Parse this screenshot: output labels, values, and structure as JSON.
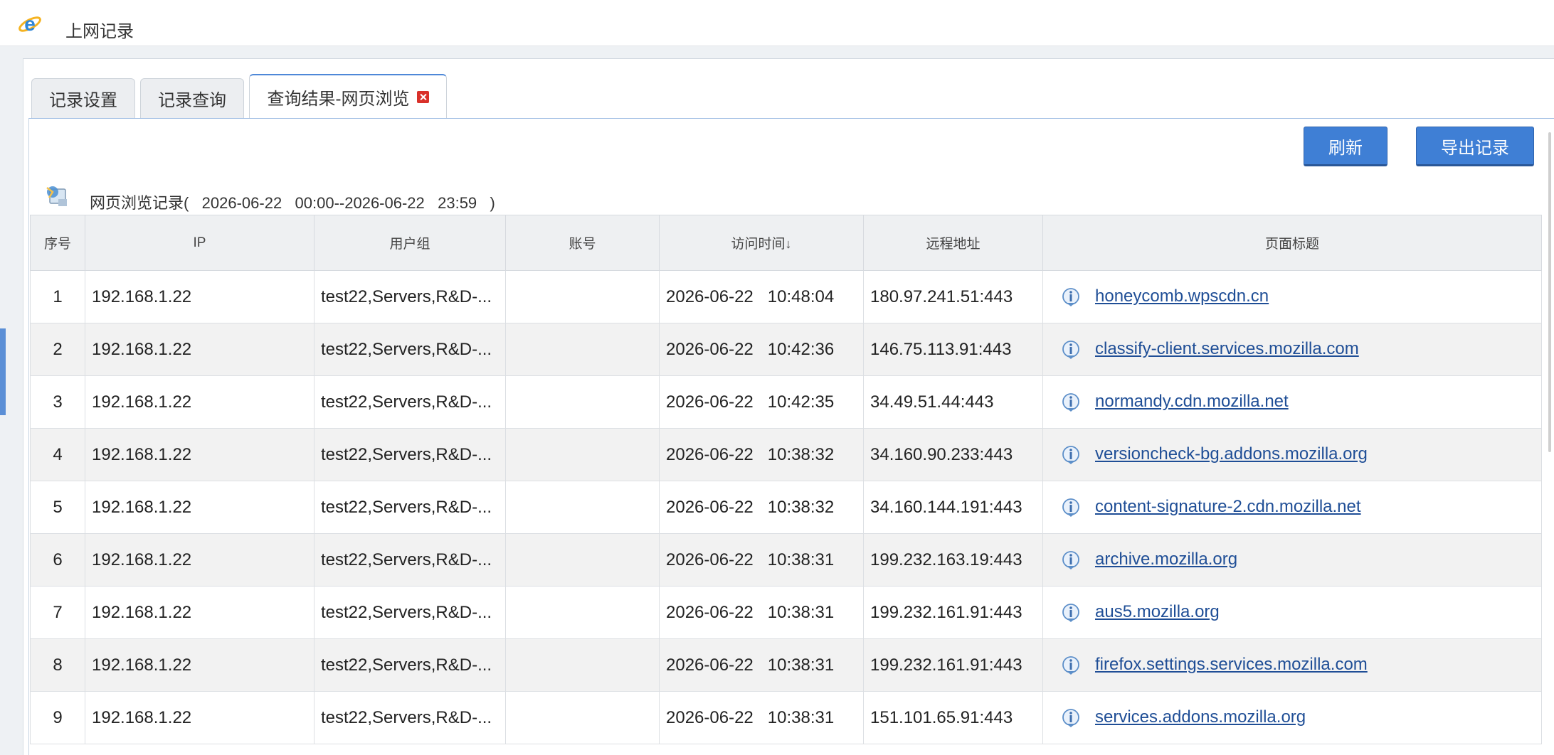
{
  "app": {
    "title": "上网记录"
  },
  "tabs": [
    {
      "label": "记录设置",
      "active": false
    },
    {
      "label": "记录查询",
      "active": false
    },
    {
      "label": "查询结果-网页浏览",
      "active": true
    }
  ],
  "toolbar": {
    "refresh_label": "刷新",
    "export_label": "导出记录"
  },
  "log_caption": "网页浏览记录(   2026-06-22   00:00--2026-06-22   23:59   )",
  "table": {
    "columns": [
      "序号",
      "IP",
      "用户组",
      "账号",
      "访问时间",
      "远程地址",
      "页面标题"
    ],
    "sort_indicator": "↓",
    "rows": [
      {
        "idx": "1",
        "ip": "192.168.1.22",
        "group": "test22,Servers,R&D-...",
        "account": "",
        "time": "2026-06-22   10:48:04",
        "remote": "180.97.241.51:443",
        "title": "honeycomb.wpscdn.cn"
      },
      {
        "idx": "2",
        "ip": "192.168.1.22",
        "group": "test22,Servers,R&D-...",
        "account": "",
        "time": "2026-06-22   10:42:36",
        "remote": "146.75.113.91:443",
        "title": "classify-client.services.mozilla.com"
      },
      {
        "idx": "3",
        "ip": "192.168.1.22",
        "group": "test22,Servers,R&D-...",
        "account": "",
        "time": "2026-06-22   10:42:35",
        "remote": "34.49.51.44:443",
        "title": "normandy.cdn.mozilla.net"
      },
      {
        "idx": "4",
        "ip": "192.168.1.22",
        "group": "test22,Servers,R&D-...",
        "account": "",
        "time": "2026-06-22   10:38:32",
        "remote": "34.160.90.233:443",
        "title": "versioncheck-bg.addons.mozilla.org"
      },
      {
        "idx": "5",
        "ip": "192.168.1.22",
        "group": "test22,Servers,R&D-...",
        "account": "",
        "time": "2026-06-22   10:38:32",
        "remote": "34.160.144.191:443",
        "title": "content-signature-2.cdn.mozilla.net"
      },
      {
        "idx": "6",
        "ip": "192.168.1.22",
        "group": "test22,Servers,R&D-...",
        "account": "",
        "time": "2026-06-22   10:38:31",
        "remote": "199.232.163.19:443",
        "title": "archive.mozilla.org"
      },
      {
        "idx": "7",
        "ip": "192.168.1.22",
        "group": "test22,Servers,R&D-...",
        "account": "",
        "time": "2026-06-22   10:38:31",
        "remote": "199.232.161.91:443",
        "title": "aus5.mozilla.org"
      },
      {
        "idx": "8",
        "ip": "192.168.1.22",
        "group": "test22,Servers,R&D-...",
        "account": "",
        "time": "2026-06-22   10:38:31",
        "remote": "199.232.161.91:443",
        "title": "firefox.settings.services.mozilla.com"
      },
      {
        "idx": "9",
        "ip": "192.168.1.22",
        "group": "test22,Servers,R&D-...",
        "account": "",
        "time": "2026-06-22   10:38:31",
        "remote": "151.101.65.91:443",
        "title": "services.addons.mozilla.org"
      }
    ]
  },
  "icons": {
    "app": "ie-browser-icon",
    "caption": "web-log-icon",
    "row": "info-icon",
    "tab_close": "close-icon"
  },
  "colors": {
    "accent": "#3f7fd5",
    "link": "#1f4e96",
    "close": "#d9312a",
    "alt_row": "#f2f2f2"
  }
}
